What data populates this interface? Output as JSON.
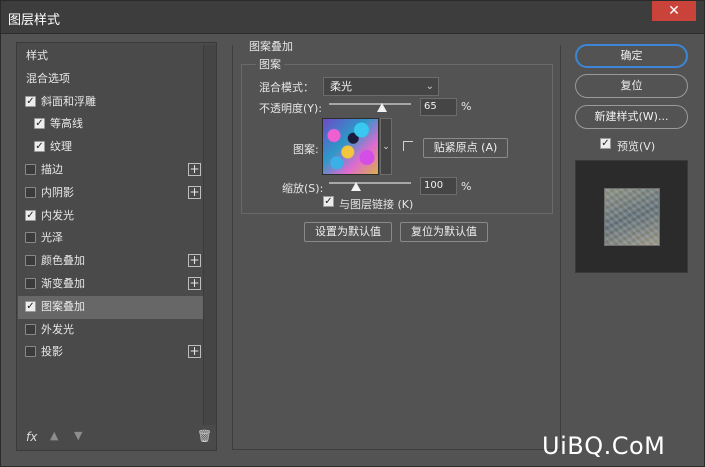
{
  "window": {
    "title": "图层样式",
    "close_glyph": "✕"
  },
  "left_panel": {
    "items": [
      {
        "label": "样式",
        "checkbox": false,
        "checked": false,
        "plus": false,
        "selected": false
      },
      {
        "label": "混合选项",
        "checkbox": false,
        "checked": false,
        "plus": false,
        "selected": false
      },
      {
        "label": "斜面和浮雕",
        "checkbox": true,
        "checked": true,
        "plus": false,
        "selected": false
      },
      {
        "label": "等高线",
        "checkbox": true,
        "checked": true,
        "plus": false,
        "selected": false,
        "indent": true
      },
      {
        "label": "纹理",
        "checkbox": true,
        "checked": true,
        "plus": false,
        "selected": false,
        "indent": true
      },
      {
        "label": "描边",
        "checkbox": true,
        "checked": false,
        "plus": true,
        "selected": false
      },
      {
        "label": "内阴影",
        "checkbox": true,
        "checked": false,
        "plus": true,
        "selected": false
      },
      {
        "label": "内发光",
        "checkbox": true,
        "checked": true,
        "plus": false,
        "selected": false
      },
      {
        "label": "光泽",
        "checkbox": true,
        "checked": false,
        "plus": false,
        "selected": false
      },
      {
        "label": "颜色叠加",
        "checkbox": true,
        "checked": false,
        "plus": true,
        "selected": false
      },
      {
        "label": "渐变叠加",
        "checkbox": true,
        "checked": false,
        "plus": true,
        "selected": false
      },
      {
        "label": "图案叠加",
        "checkbox": true,
        "checked": true,
        "plus": false,
        "selected": true
      },
      {
        "label": "外发光",
        "checkbox": true,
        "checked": false,
        "plus": false,
        "selected": false
      },
      {
        "label": "投影",
        "checkbox": true,
        "checked": false,
        "plus": true,
        "selected": false
      }
    ],
    "footer": {
      "fx_label": "fx",
      "up_glyph": "▲",
      "down_glyph": "▼",
      "trash_glyph": "🗑"
    }
  },
  "main": {
    "group_title": "图案叠加",
    "sub_title": "图案",
    "blend_mode_label": "混合模式：",
    "blend_mode_value": "柔光",
    "opacity_label": "不透明度(Y):",
    "opacity_value": "65",
    "opacity_fraction": 0.65,
    "percent_sign": "%",
    "pattern_label": "图案:",
    "snap_button": "贴紧原点 (A)",
    "scale_label": "缩放(S):",
    "scale_value": "100",
    "scale_fraction": 0.33,
    "link_label": "与图层链接 (K)",
    "link_checked": true,
    "set_default_button": "设置为默认值",
    "reset_default_button": "复位为默认值"
  },
  "right": {
    "ok_button": "确定",
    "reset_button": "复位",
    "new_style_button": "新建样式(W)...",
    "preview_label": "预览(V)",
    "preview_checked": true
  },
  "watermark": "UiBQ.CoM",
  "colors": {
    "accent": "#3e85d6",
    "close": "#c9433a",
    "background": "#535353"
  }
}
